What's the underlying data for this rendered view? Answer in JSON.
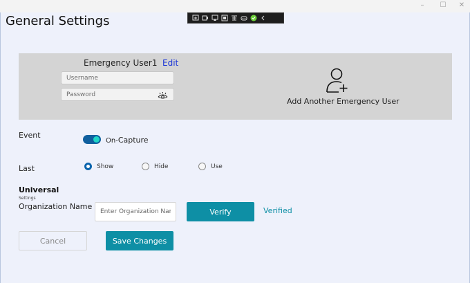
{
  "window": {
    "min": "–",
    "max": "☐",
    "close": "✕"
  },
  "page_title": "General Settings",
  "toolbar_icons": [
    "screen-share-icon",
    "video-icon",
    "cast-icon",
    "window-icon",
    "network-icon",
    "gamepad-icon",
    "check-circle-icon",
    "chevron-left-icon"
  ],
  "emergency": {
    "title": "Emergency User1",
    "edit": "Edit",
    "username_placeholder": "Username",
    "password_placeholder": "Password",
    "add_label": "Add Another Emergency User"
  },
  "event": {
    "label": "Event",
    "toggle_on": true,
    "toggle_prefix": "On-",
    "toggle_suffix": "Capture"
  },
  "last": {
    "label": "Last",
    "options": [
      "Show",
      "Hide",
      "Use"
    ],
    "selected": "Show"
  },
  "universal": {
    "title": "Universal",
    "subtitle": "Settings",
    "org_label": "Organization Name",
    "org_placeholder": "Enter Organization Name",
    "verify": "Verify",
    "verified": "Verified"
  },
  "actions": {
    "cancel": "Cancel",
    "save": "Save Changes"
  },
  "colors": {
    "accent": "#0e8fa5",
    "toggle": "#0f5f9e",
    "link": "#1a35d6",
    "panel": "#d4d4d4",
    "background": "#eef1fb"
  }
}
